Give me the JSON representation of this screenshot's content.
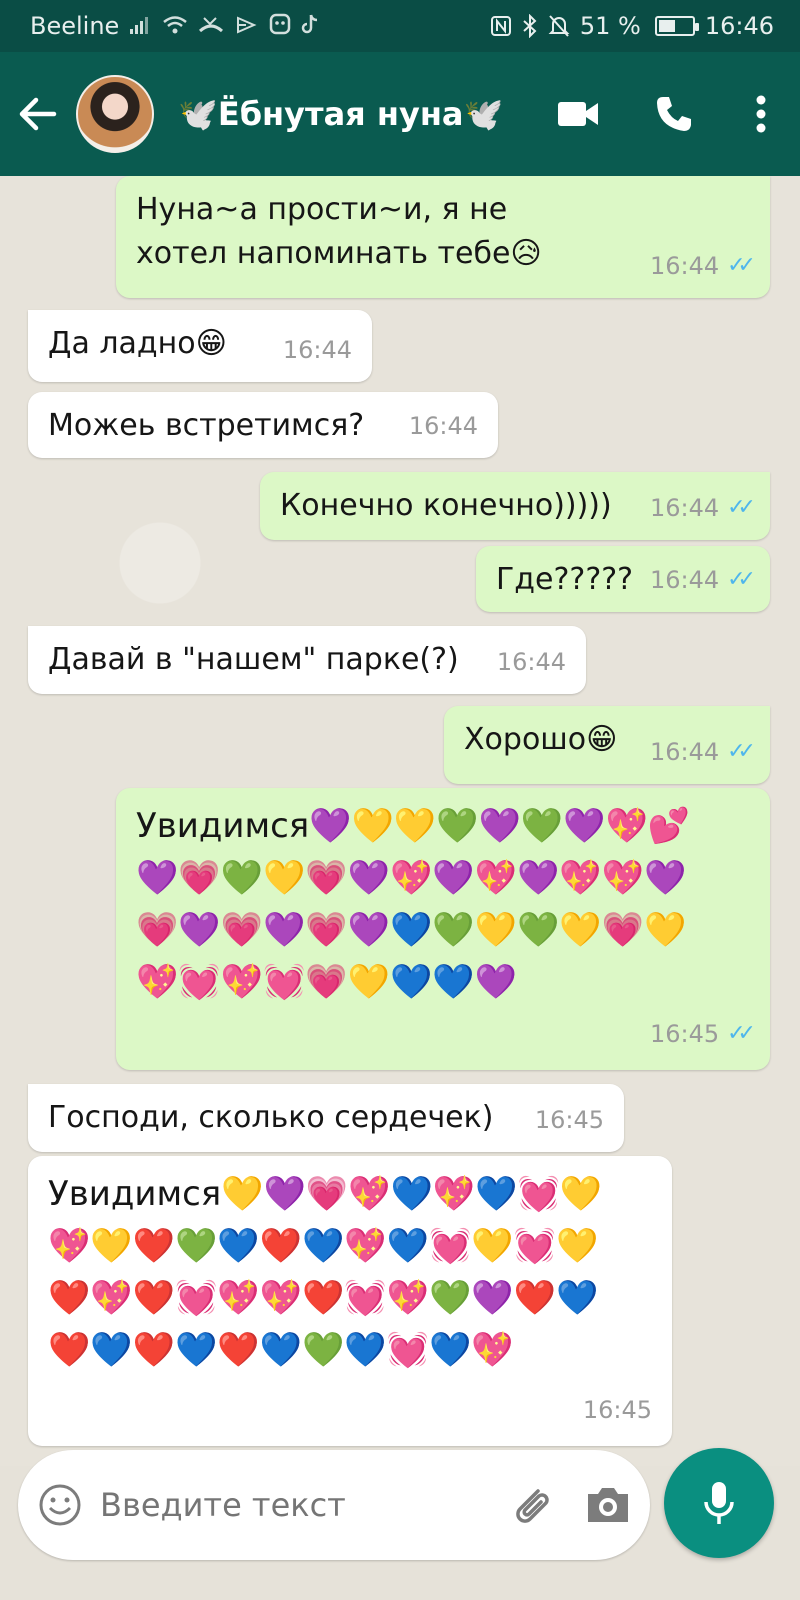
{
  "status_bar": {
    "carrier": "Beeline",
    "battery_percent": "51 %",
    "battery_level": 0.51,
    "time": "16:46",
    "icons_left": [
      "signal-icon",
      "wifi-icon",
      "missed-call-icon",
      "play-icon",
      "shield-icon",
      "tiktok-icon"
    ],
    "icons_right": [
      "nfc-icon",
      "bluetooth-icon",
      "mute-icon"
    ]
  },
  "header": {
    "title": "🕊️Ёбнутая нуна🕊️",
    "actions": [
      "video-call-icon",
      "phone-icon",
      "more-icon"
    ]
  },
  "messages": [
    {
      "dir": "out",
      "text": "Нуна~а прости~и, я не хотел напоминать тебе😥",
      "time": "16:44",
      "ticks": "✓✓"
    },
    {
      "dir": "in",
      "text": "Да ладно😁",
      "time": "16:44"
    },
    {
      "dir": "in",
      "text": "Можеь встретимся?",
      "time": "16:44"
    },
    {
      "dir": "out",
      "text": "Конечно конечно)))))",
      "time": "16:44",
      "ticks": "✓✓"
    },
    {
      "dir": "out",
      "text": "Где?????",
      "time": "16:44",
      "ticks": "✓✓"
    },
    {
      "dir": "in",
      "text": "Давай в \"нашем\" парке(?)",
      "time": "16:44"
    },
    {
      "dir": "out",
      "text": "Хорошо😁",
      "time": "16:44",
      "ticks": "✓✓"
    },
    {
      "dir": "out",
      "text": "Увидимся💜💛💛💚💜💚💜💖💕💜💗💚💛💗💜💖💜💖💜💖💖💜💗💜💗💜💗💜💙💚💛💚💛💗💛💖💓💖💓💗💛💙💙💜",
      "time": "16:45",
      "ticks": "✓✓"
    },
    {
      "dir": "in",
      "text": "Господи, сколько сердечек)",
      "time": "16:45"
    },
    {
      "dir": "in",
      "text": "Увидимся💛💜💗💖💙💖💙💓💛💖💛❤️💚💙❤️💙💖💙💓💛💓💛❤️💖❤️💓💖💖❤️💓💖💚💜❤️💙❤️💙❤️💙❤️💙💚💙💓💙💖",
      "time": "16:45"
    }
  ],
  "composer": {
    "placeholder": "Введите текст",
    "icons": [
      "emoji-icon",
      "paperclip-icon",
      "camera-icon",
      "mic-icon"
    ]
  },
  "colors": {
    "status_bar": "#0a4d45",
    "app_bar": "#0a5b50",
    "outgoing_bubble": "#dcf8c6",
    "incoming_bubble": "#ffffff",
    "read_ticks": "#4fb6ec",
    "mic_button": "#0a8f80"
  }
}
